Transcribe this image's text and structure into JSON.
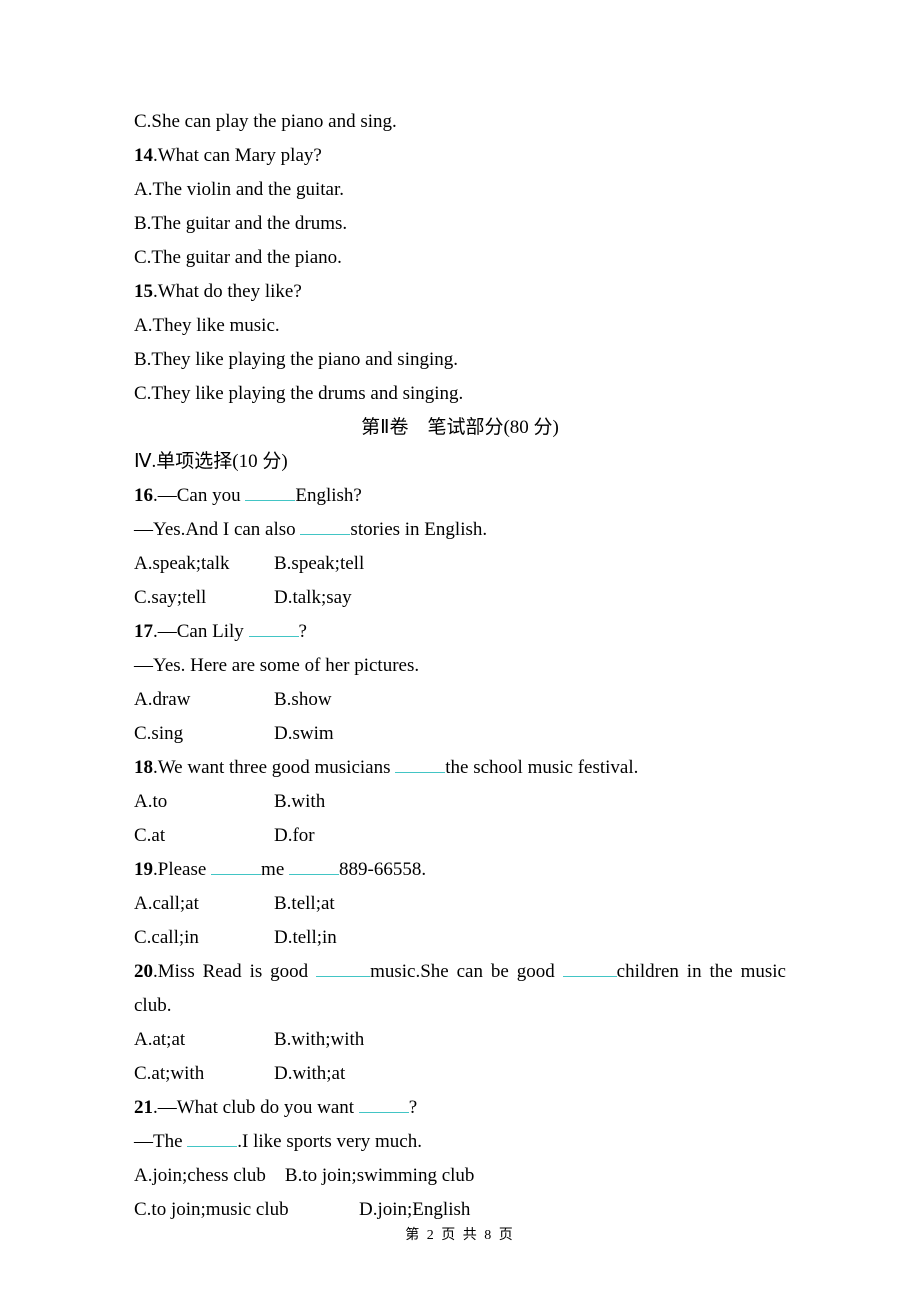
{
  "q13_optC": "C.She can play the piano and sing.",
  "q14": {
    "num": "14",
    "stem": ".What can Mary play?",
    "a": "A.The violin and the guitar.",
    "b": "B.The guitar and the drums.",
    "c": "C.The guitar and the piano."
  },
  "q15": {
    "num": "15",
    "stem": ".What do they like?",
    "a": "A.They like music.",
    "b": "B.They like playing the piano and singing.",
    "c": "C.They like playing the drums and singing."
  },
  "part2_heading": "第Ⅱ卷　笔试部分(80 分)",
  "section4_heading": "Ⅳ.单项选择(10 分)",
  "q16": {
    "num": "16",
    "stem_pre": ".—Can you ",
    "stem_post": "English?",
    "reply_pre": "—Yes.And I can also ",
    "reply_post": "stories in English.",
    "a": "A.speak;talk",
    "b": "B.speak;tell",
    "c": "C.say;tell",
    "d": "D.talk;say"
  },
  "q17": {
    "num": "17",
    "stem_pre": ".—Can Lily ",
    "stem_post": "?",
    "reply": "—Yes. Here are some of her pictures.",
    "a": "A.draw",
    "b": "B.show",
    "c": "C.sing",
    "d": "D.swim"
  },
  "q18": {
    "num": "18",
    "stem_pre": ".We want three good musicians ",
    "stem_post": "the school music festival.",
    "a": "A.to",
    "b": "B.with",
    "c": "C.at",
    "d": "D.for"
  },
  "q19": {
    "num": "19",
    "stem_pre": ".Please ",
    "stem_mid": "me ",
    "stem_post": "889-66558.",
    "a": "A.call;at",
    "b": "B.tell;at",
    "c": "C.call;in",
    "d": "D.tell;in"
  },
  "q20": {
    "num": "20",
    "stem_pre": ".Miss Read is good ",
    "stem_mid": "music.She can be good ",
    "stem_post": "children in the music",
    "cont": "club.",
    "a": "A.at;at",
    "b": "B.with;with",
    "c": "C.at;with",
    "d": "D.with;at"
  },
  "q21": {
    "num": "21",
    "stem_pre": ".—What club do you want ",
    "stem_post": "?",
    "reply_pre": "—The ",
    "reply_post": ".I like sports very much.",
    "ab": "A.join;chess club　B.to join;swimming club",
    "c": "C.to join;music club",
    "d": "D.join;English"
  },
  "footer": "第 2 页 共 8 页"
}
